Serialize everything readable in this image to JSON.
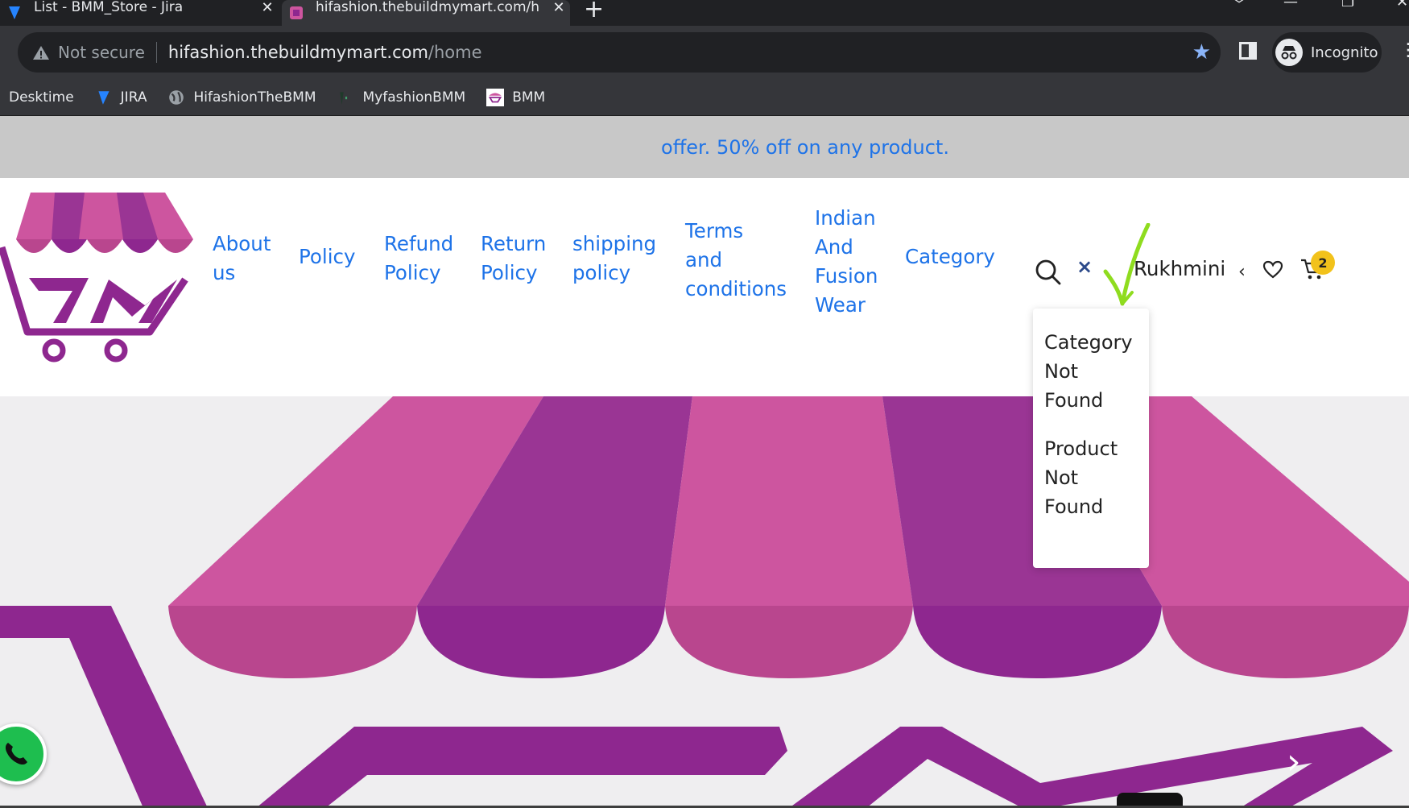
{
  "browser": {
    "tabs": [
      {
        "title": "List - BMM_Store - Jira",
        "close": "✕"
      },
      {
        "title": "hifashion.thebuildmymart.com/h",
        "close": "✕"
      }
    ],
    "new_tab": "+",
    "window_controls": [
      "﹀",
      "—",
      "❐",
      "✕"
    ],
    "security_label": "Not secure",
    "url_host": "hifashion.thebuildmymart.com",
    "url_path": "/home",
    "profile_label": "Incognito",
    "bookmarks": [
      "Desktime",
      "JIRA",
      "HifashionTheBMM",
      "MyfashionBMM",
      "BMM"
    ],
    "menu_glyph": "⋮"
  },
  "site": {
    "offer_text": "offer. 50% off on any product.",
    "nav": [
      [
        "About",
        "us"
      ],
      [
        "Policy"
      ],
      [
        "Refund",
        "Policy"
      ],
      [
        "Return",
        "Policy"
      ],
      [
        "shipping",
        "policy"
      ],
      [
        "Terms",
        "and",
        "conditions"
      ],
      [
        "Indian",
        "And",
        "Fusion",
        "Wear"
      ],
      [
        "Category"
      ]
    ],
    "search_clear": "×",
    "user_name": "Rukhmini",
    "user_glyph": "‹",
    "cart_count": "2",
    "search_results": {
      "category": [
        "Category",
        "Not",
        "Found"
      ],
      "product": [
        "Product",
        "Not",
        "Found"
      ]
    },
    "slider_next": "›"
  },
  "colors": {
    "link_blue": "#1e73e8",
    "offer_bg": "#c8c8c8",
    "brand_pink": "#cd559f",
    "brand_purple": "#8e278f",
    "annotation_green": "#8fdc1f",
    "badge_yellow": "#f2c21b"
  },
  "icons": {
    "search": "search-icon",
    "clear": "close-icon",
    "wishlist": "heart-icon",
    "cart": "cart-icon",
    "whatsapp": "whatsapp-icon",
    "next": "chevron-right-icon",
    "incognito": "incognito-icon",
    "star": "star-icon"
  }
}
